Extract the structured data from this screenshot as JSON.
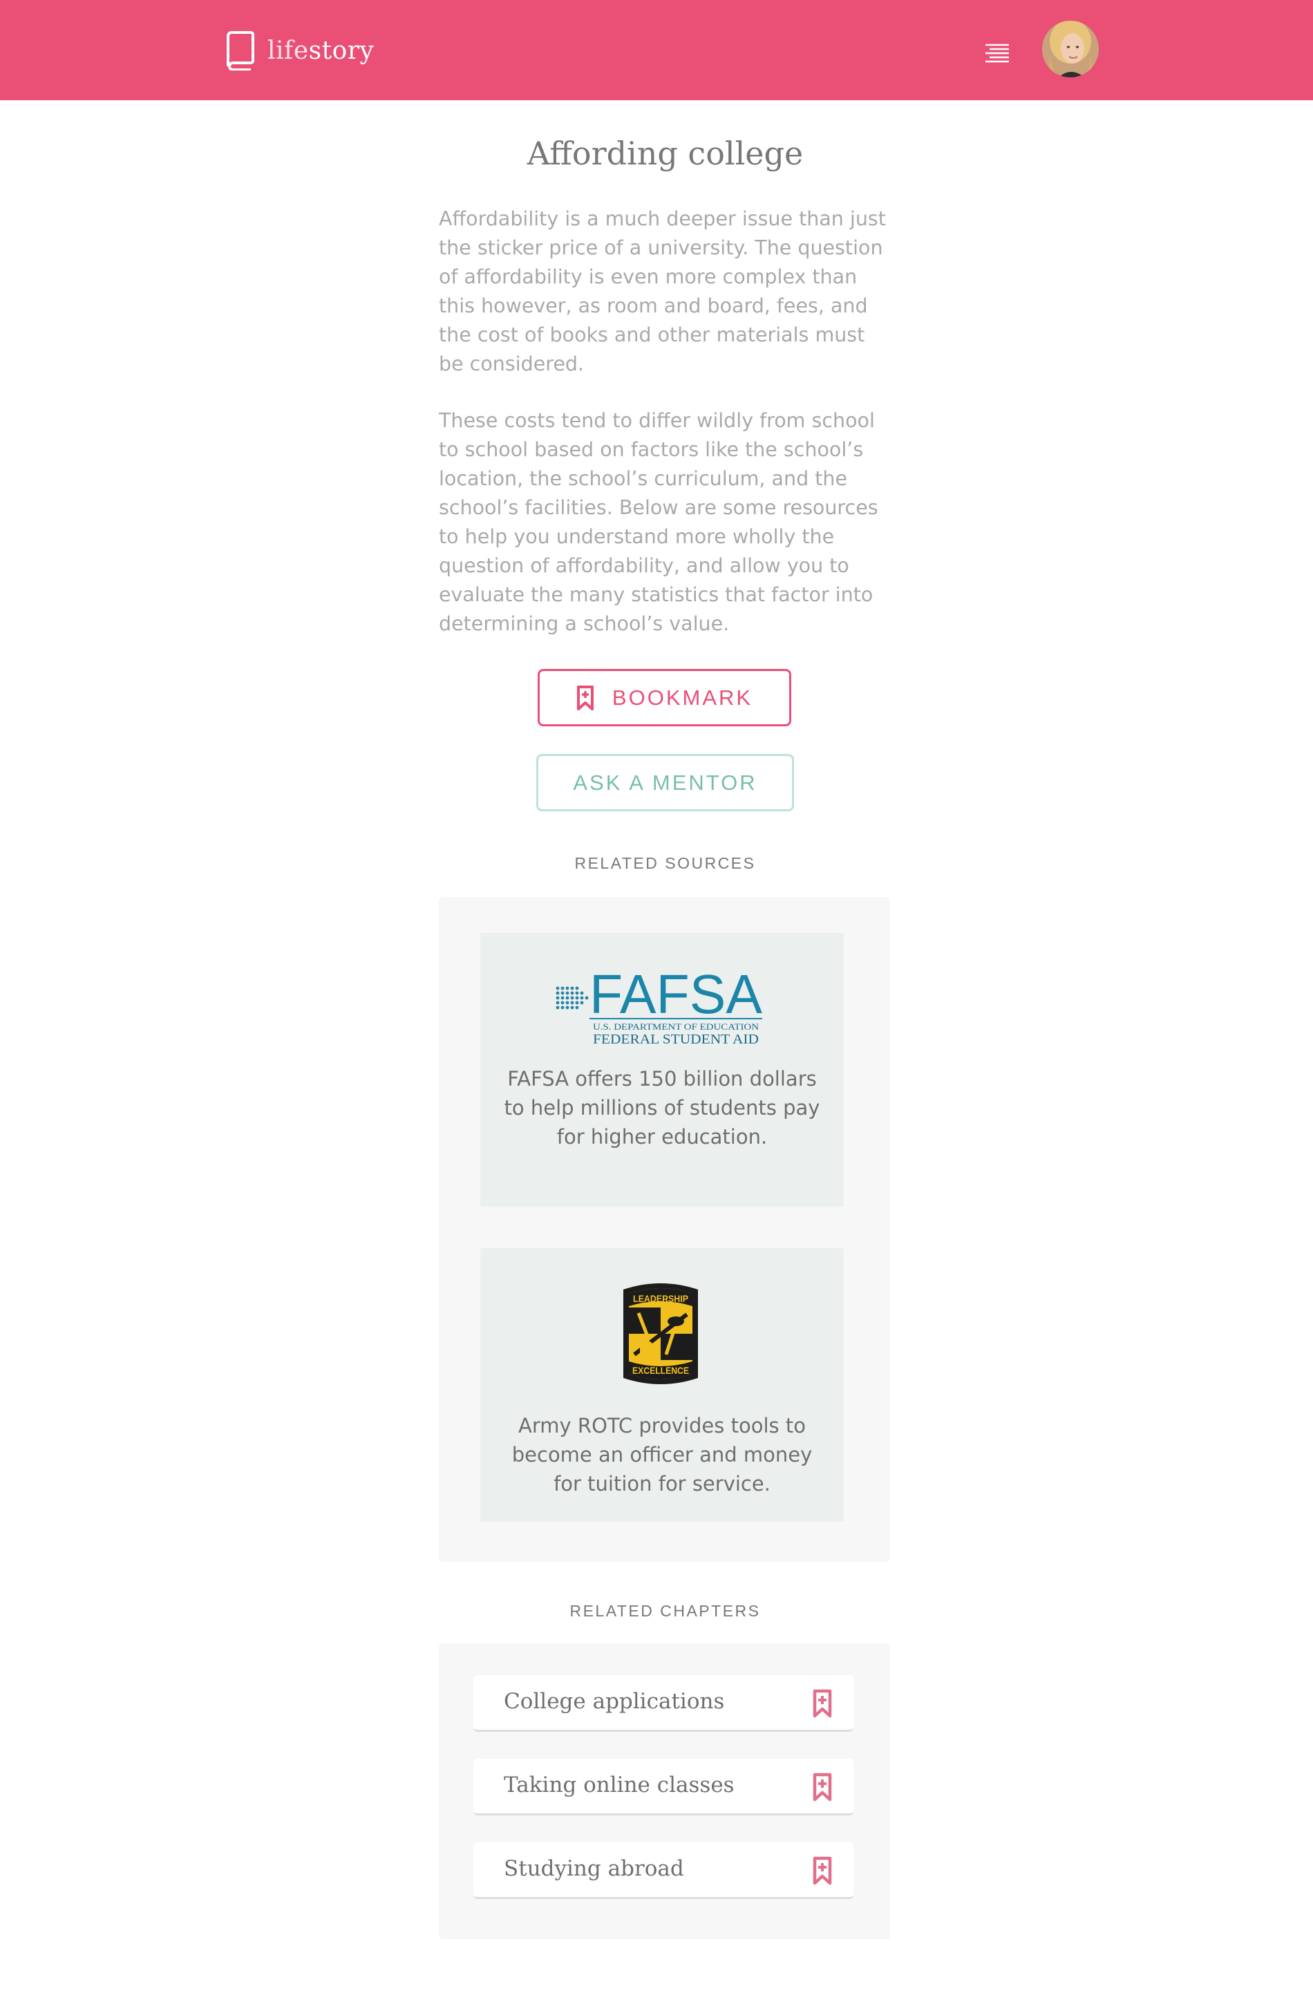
{
  "header": {
    "brand_light": "life",
    "brand_bold": "story",
    "icons": {
      "logo": "book-icon",
      "menu": "menu-icon",
      "avatar": "user-avatar"
    },
    "colors": {
      "brand": "#ea4f76"
    }
  },
  "article": {
    "title": "Affording college",
    "paragraphs": [
      "Affordability is a much deeper issue than just the sticker price of a university. The question of affordability is even more complex than this however, as room and board, fees, and the cost of books and other materials must be considered.",
      "These costs tend to differ wildly from school to school based on factors like the school’s location, the school’s curriculum, and the school’s facilities. Below are some resources to help you understand more wholly the question of affordability, and allow you to evaluate the many statistics that factor into determining a school’s value."
    ],
    "bookmark_label": "BOOKMARK",
    "mentor_label": "ASK A MENTOR"
  },
  "related_sources": {
    "label": "RELATED SOURCES",
    "items": [
      {
        "logo_text": "FAFSA",
        "logo_sub1": "U.S. DEPARTMENT OF EDUCATION",
        "logo_sub2": "FEDERAL STUDENT AID",
        "description": "FAFSA offers 150 billion dollars to help millions of students pay for higher education."
      },
      {
        "logo_top": "LEADERSHIP",
        "logo_bottom": "EXCELLENCE",
        "description": "Army ROTC provides tools to become an officer and money for tuition for service."
      }
    ]
  },
  "related_chapters": {
    "label": "RELATED CHAPTERS",
    "items": [
      {
        "title": "College applications"
      },
      {
        "title": "Taking online classes"
      },
      {
        "title": "Studying abroad"
      }
    ]
  }
}
